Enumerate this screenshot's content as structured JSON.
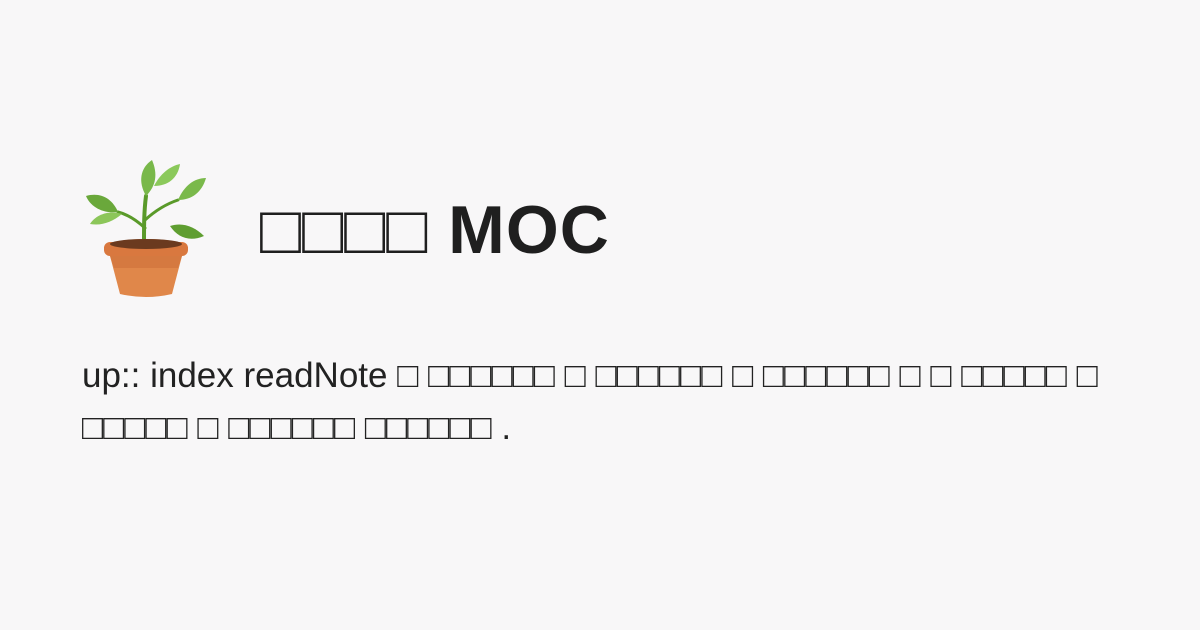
{
  "header": {
    "icon": "potted-plant-icon",
    "title": "□□□□ MOC"
  },
  "body": {
    "text": "up:: index readNote □ □□□□□□ □ □□□□□□ □ □□□□□□ □ □ □□□□□ □ □□□□□ □ □□□□□□ □□□□□□ ."
  },
  "colors": {
    "background": "#f8f7f8",
    "text": "#1f1f1f"
  }
}
